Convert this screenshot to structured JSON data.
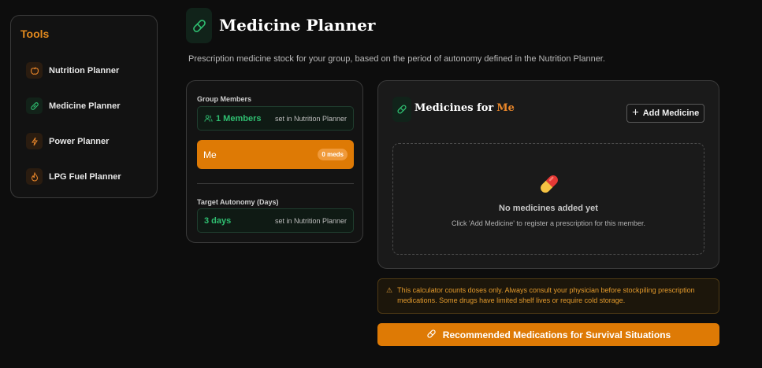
{
  "sidebar": {
    "title": "Tools",
    "items": [
      {
        "label": "Nutrition Planner",
        "icon": "apple-icon"
      },
      {
        "label": "Medicine Planner",
        "icon": "pill-icon"
      },
      {
        "label": "Power Planner",
        "icon": "bolt-icon"
      },
      {
        "label": "LPG Fuel Planner",
        "icon": "flame-icon"
      }
    ]
  },
  "header": {
    "title": "Medicine Planner",
    "subtitle": "Prescription medicine stock for your group, based on the period of autonomy defined in the Nutrition Planner."
  },
  "group": {
    "label": "Group Members",
    "value": "1 Members",
    "note": "set in Nutrition Planner",
    "member_name": "Me",
    "member_badge": "0 meds"
  },
  "autonomy": {
    "label": "Target Autonomy (Days)",
    "value": "3 days",
    "note": "set in Nutrition Planner"
  },
  "medicines": {
    "title": "Medicines for",
    "member": "Me",
    "add_label": "Add Medicine",
    "empty_title": "No medicines added yet",
    "empty_sub": "Click 'Add Medicine' to register a prescription for this member."
  },
  "warning": {
    "icon": "⚠",
    "text": "This calculator counts doses only. Always consult your physician before stockpiling prescription medications. Some drugs have limited shelf lives or require cold storage."
  },
  "reco_button": {
    "label": "Recommended Medications for Survival Situations"
  },
  "colors": {
    "accent": "#de7a05",
    "green": "#2fbf71",
    "background": "#0d0d0d"
  }
}
